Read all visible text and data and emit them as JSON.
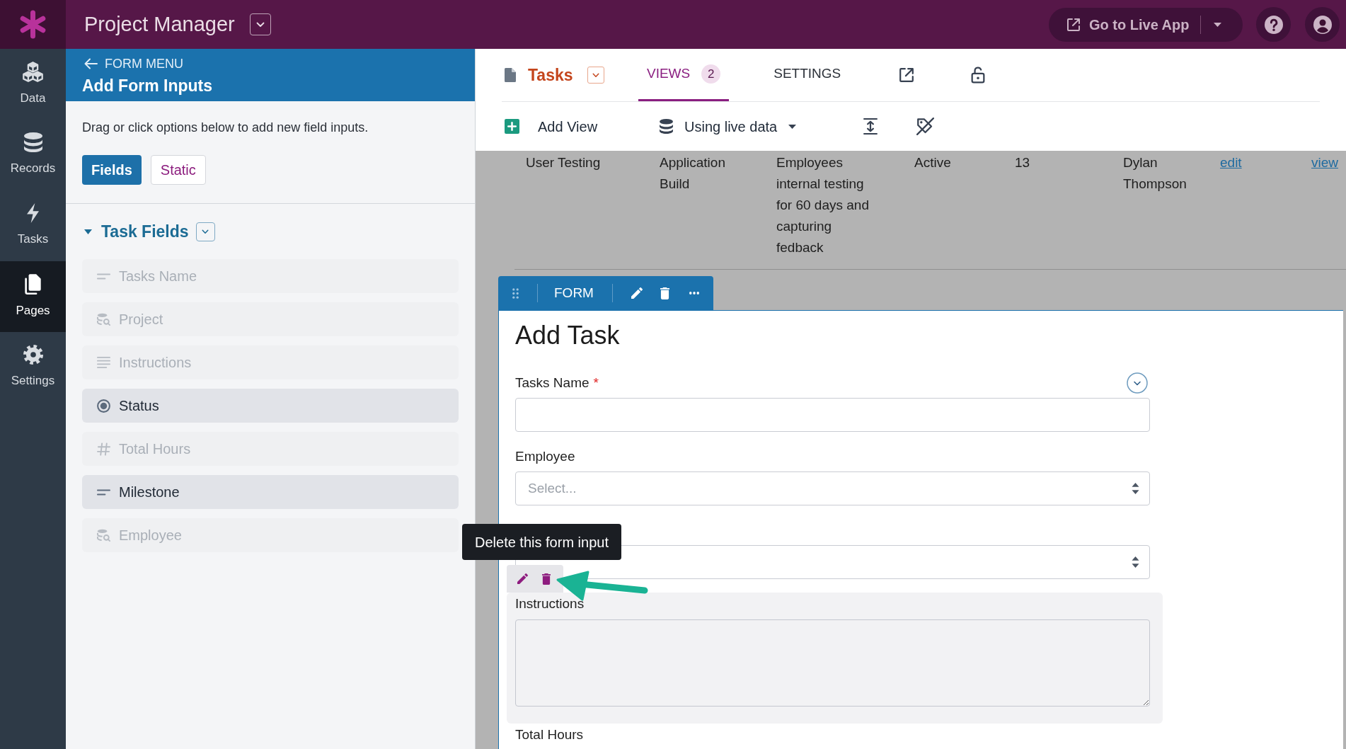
{
  "app_bar": {
    "title": "Project Manager",
    "live_app_button": "Go to Live App"
  },
  "nav_rail": [
    {
      "label": "Data",
      "kind": "data",
      "selected": false
    },
    {
      "label": "Records",
      "kind": "records",
      "selected": false
    },
    {
      "label": "Tasks",
      "kind": "tasks",
      "selected": false
    },
    {
      "label": "Pages",
      "kind": "pages",
      "selected": true
    },
    {
      "label": "Settings",
      "kind": "settings",
      "selected": false
    }
  ],
  "form_menu": {
    "back_label": "FORM MENU",
    "title": "Add Form Inputs",
    "description": "Drag or click options below to add new field inputs.",
    "tabs": [
      {
        "label": "Fields",
        "selected": true
      },
      {
        "label": "Static",
        "selected": false
      }
    ],
    "group": {
      "title": "Task Fields",
      "expanded": true,
      "items": [
        {
          "label": "Tasks Name",
          "kind": "short-text",
          "disabled": true
        },
        {
          "label": "Project",
          "kind": "connection",
          "disabled": true
        },
        {
          "label": "Instructions",
          "kind": "paragraph",
          "disabled": true
        },
        {
          "label": "Status",
          "kind": "choice",
          "disabled": false
        },
        {
          "label": "Total Hours",
          "kind": "number",
          "disabled": true
        },
        {
          "label": "Milestone",
          "kind": "short-text",
          "disabled": false
        },
        {
          "label": "Employee",
          "kind": "connection",
          "disabled": true
        }
      ]
    }
  },
  "page_header": {
    "page_title": "Tasks",
    "tabs": [
      {
        "label": "VIEWS",
        "badge": "2",
        "selected": true
      },
      {
        "label": "SETTINGS",
        "selected": false
      }
    ]
  },
  "view_toolbar": {
    "add_view": "Add View",
    "data_source": "Using live data"
  },
  "table": {
    "rows": [
      {
        "cells": [
          {
            "kind": "text",
            "text": "User Testing"
          },
          {
            "kind": "text",
            "text": "Application Build"
          },
          {
            "kind": "text",
            "text": "Employees internal testing for 60 days and capturing fedback"
          },
          {
            "kind": "text",
            "text": "Active"
          },
          {
            "kind": "text",
            "text": "13"
          },
          {
            "kind": "text",
            "text": "Dylan Thompson"
          },
          {
            "kind": "link",
            "text": "edit"
          },
          {
            "kind": "link",
            "text": "view"
          }
        ]
      }
    ]
  },
  "form_view": {
    "toolbar_label": "FORM",
    "title": "Add Task",
    "fields": [
      {
        "kind": "text",
        "label": "Tasks Name",
        "required_mark": "*",
        "collapsible": true,
        "hovered": false
      },
      {
        "kind": "select",
        "label": "Employee",
        "placeholder": "Select...",
        "hovered": false
      },
      {
        "kind": "select",
        "hovered": false
      },
      {
        "kind": "textarea",
        "label": "Instructions",
        "hovered": true,
        "tooltip": "Delete this form input"
      },
      {
        "kind": "number",
        "label": "Total Hours",
        "hovered": false
      }
    ]
  }
}
